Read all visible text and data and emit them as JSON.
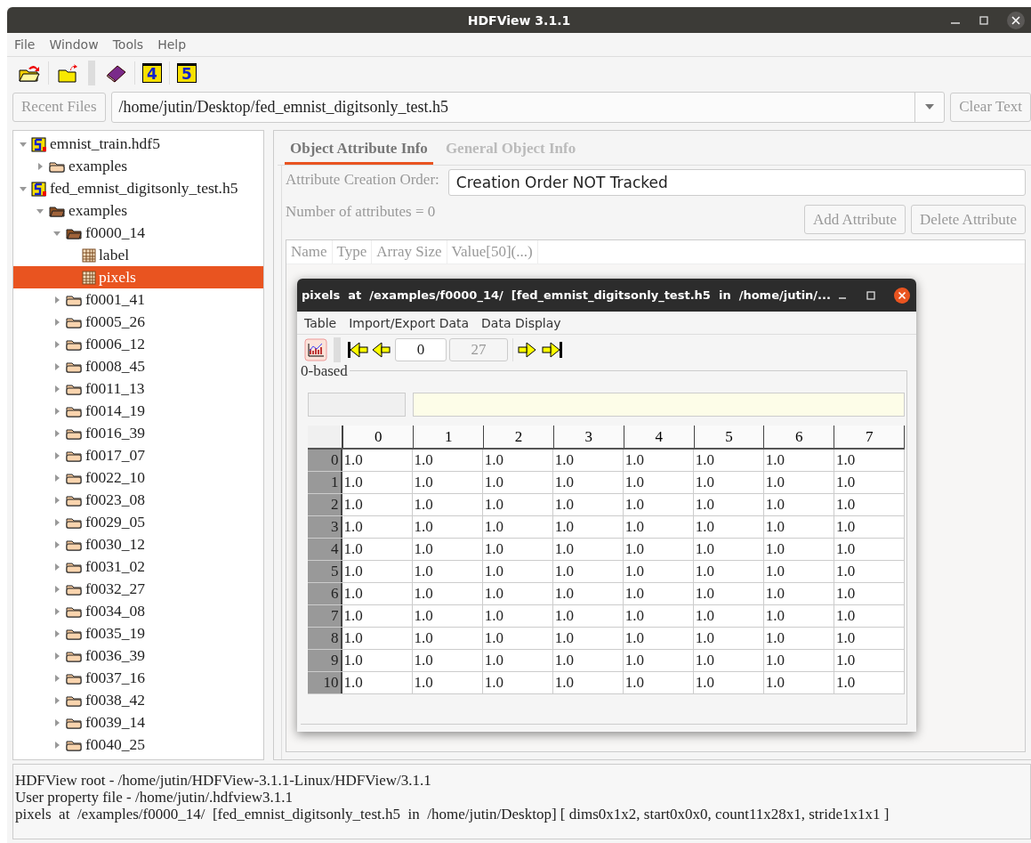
{
  "window": {
    "title": "HDFView 3.1.1"
  },
  "menu": [
    "File",
    "Window",
    "Tools",
    "Help"
  ],
  "toolbar": [
    {
      "kind": "open"
    },
    {
      "kind": "close"
    },
    {
      "kind": "grip"
    },
    {
      "kind": "help"
    },
    {
      "kind": "hdf",
      "label": "4"
    },
    {
      "kind": "hdf",
      "label": "5"
    }
  ],
  "recent_files_button": "Recent Files",
  "file_path": "/home/jutin/Desktop/fed_emnist_digitsonly_test.h5",
  "clear_text_button": "Clear Text",
  "tree": [
    {
      "label": "emnist_train.hdf5",
      "kind": "file",
      "expanded": true,
      "selected": false,
      "children": [
        {
          "label": "examples",
          "kind": "group",
          "expanded": false,
          "selected": false
        }
      ]
    },
    {
      "label": "fed_emnist_digitsonly_test.h5",
      "kind": "file",
      "expanded": true,
      "selected": false,
      "children": [
        {
          "label": "examples",
          "kind": "group",
          "expanded": true,
          "selected": false,
          "children": [
            {
              "label": "f0000_14",
              "kind": "group",
              "expanded": true,
              "selected": false,
              "children": [
                {
                  "label": "label",
                  "kind": "dataset",
                  "selected": false
                },
                {
                  "label": "pixels",
                  "kind": "dataset",
                  "selected": true
                }
              ]
            },
            {
              "label": "f0001_41",
              "kind": "group",
              "expanded": false,
              "selected": false
            },
            {
              "label": "f0005_26",
              "kind": "group",
              "expanded": false,
              "selected": false
            },
            {
              "label": "f0006_12",
              "kind": "group",
              "expanded": false,
              "selected": false
            },
            {
              "label": "f0008_45",
              "kind": "group",
              "expanded": false,
              "selected": false
            },
            {
              "label": "f0011_13",
              "kind": "group",
              "expanded": false,
              "selected": false
            },
            {
              "label": "f0014_19",
              "kind": "group",
              "expanded": false,
              "selected": false
            },
            {
              "label": "f0016_39",
              "kind": "group",
              "expanded": false,
              "selected": false
            },
            {
              "label": "f0017_07",
              "kind": "group",
              "expanded": false,
              "selected": false
            },
            {
              "label": "f0022_10",
              "kind": "group",
              "expanded": false,
              "selected": false
            },
            {
              "label": "f0023_08",
              "kind": "group",
              "expanded": false,
              "selected": false
            },
            {
              "label": "f0029_05",
              "kind": "group",
              "expanded": false,
              "selected": false
            },
            {
              "label": "f0030_12",
              "kind": "group",
              "expanded": false,
              "selected": false
            },
            {
              "label": "f0031_02",
              "kind": "group",
              "expanded": false,
              "selected": false
            },
            {
              "label": "f0032_27",
              "kind": "group",
              "expanded": false,
              "selected": false
            },
            {
              "label": "f0034_08",
              "kind": "group",
              "expanded": false,
              "selected": false
            },
            {
              "label": "f0035_19",
              "kind": "group",
              "expanded": false,
              "selected": false
            },
            {
              "label": "f0036_39",
              "kind": "group",
              "expanded": false,
              "selected": false
            },
            {
              "label": "f0037_16",
              "kind": "group",
              "expanded": false,
              "selected": false
            },
            {
              "label": "f0038_42",
              "kind": "group",
              "expanded": false,
              "selected": false
            },
            {
              "label": "f0039_14",
              "kind": "group",
              "expanded": false,
              "selected": false
            },
            {
              "label": "f0040_25",
              "kind": "group",
              "expanded": false,
              "selected": false
            }
          ]
        }
      ]
    }
  ],
  "tabs": [
    {
      "label": "Object Attribute Info",
      "selected": true
    },
    {
      "label": "General Object Info",
      "selected": false
    }
  ],
  "attribute_creation_order_label": "Attribute Creation Order:",
  "attribute_creation_order": "Creation Order NOT Tracked",
  "attribute_count": "Number of attributes = 0",
  "attribute_buttons": [
    {
      "label": "Add Attribute",
      "disabled": true
    },
    {
      "label": "Delete Attribute",
      "disabled": true
    }
  ],
  "attribute_table": {
    "columns": [
      "Name",
      "Type",
      "Array Size",
      "Value[50](...)"
    ]
  },
  "data_window": {
    "title": "pixels  at  /examples/f0000_14/  [fed_emnist_digitsonly_test.h5  in  /home/jutin/...",
    "menu": [
      "Table",
      "Import/Export Data",
      "Data Display"
    ],
    "page": "0",
    "page_count": "27",
    "index_label": "0-based",
    "table": {
      "columns": [
        "0",
        "1",
        "2",
        "3",
        "4",
        "5",
        "6",
        "7"
      ],
      "rows": [
        {
          "header": "0",
          "cells": [
            "1.0",
            "1.0",
            "1.0",
            "1.0",
            "1.0",
            "1.0",
            "1.0",
            "1.0"
          ]
        },
        {
          "header": "1",
          "cells": [
            "1.0",
            "1.0",
            "1.0",
            "1.0",
            "1.0",
            "1.0",
            "1.0",
            "1.0"
          ]
        },
        {
          "header": "2",
          "cells": [
            "1.0",
            "1.0",
            "1.0",
            "1.0",
            "1.0",
            "1.0",
            "1.0",
            "1.0"
          ]
        },
        {
          "header": "3",
          "cells": [
            "1.0",
            "1.0",
            "1.0",
            "1.0",
            "1.0",
            "1.0",
            "1.0",
            "1.0"
          ]
        },
        {
          "header": "4",
          "cells": [
            "1.0",
            "1.0",
            "1.0",
            "1.0",
            "1.0",
            "1.0",
            "1.0",
            "1.0"
          ]
        },
        {
          "header": "5",
          "cells": [
            "1.0",
            "1.0",
            "1.0",
            "1.0",
            "1.0",
            "1.0",
            "1.0",
            "1.0"
          ]
        },
        {
          "header": "6",
          "cells": [
            "1.0",
            "1.0",
            "1.0",
            "1.0",
            "1.0",
            "1.0",
            "1.0",
            "1.0"
          ]
        },
        {
          "header": "7",
          "cells": [
            "1.0",
            "1.0",
            "1.0",
            "1.0",
            "1.0",
            "1.0",
            "1.0",
            "1.0"
          ]
        },
        {
          "header": "8",
          "cells": [
            "1.0",
            "1.0",
            "1.0",
            "1.0",
            "1.0",
            "1.0",
            "1.0",
            "1.0"
          ]
        },
        {
          "header": "9",
          "cells": [
            "1.0",
            "1.0",
            "1.0",
            "1.0",
            "1.0",
            "1.0",
            "1.0",
            "1.0"
          ]
        },
        {
          "header": "10",
          "cells": [
            "1.0",
            "1.0",
            "1.0",
            "1.0",
            "1.0",
            "1.0",
            "1.0",
            "1.0"
          ]
        }
      ]
    }
  },
  "status_lines": [
    "HDFView root - /home/jutin/HDFView-3.1.1-Linux/HDFView/3.1.1",
    "User property file - /home/jutin/.hdfview3.1.1",
    "pixels  at  /examples/f0000_14/  [fed_emnist_digitsonly_test.h5  in  /home/jutin/Desktop] [ dims0x1x2, start0x0x0, count11x28x1, stride1x1x1 ]"
  ]
}
